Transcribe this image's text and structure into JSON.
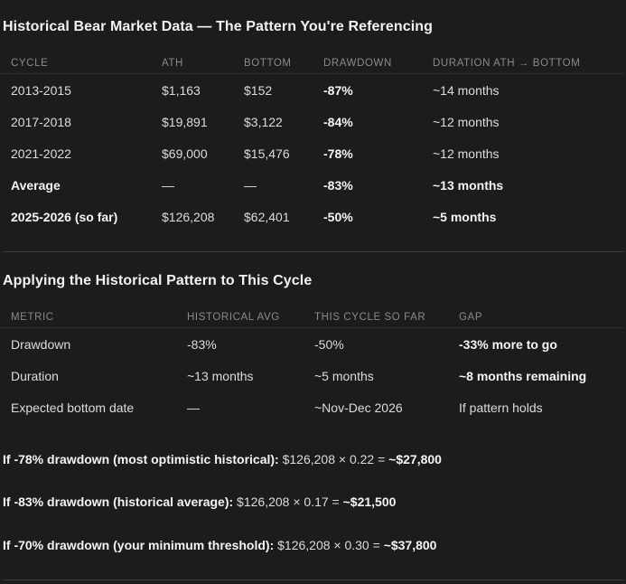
{
  "section1": {
    "title": "Historical Bear Market Data — The Pattern You're Referencing",
    "columns": [
      "CYCLE",
      "ATH",
      "BOTTOM",
      "DRAWDOWN",
      "DURATION ATH → BOTTOM"
    ],
    "rows": [
      {
        "cycle": "2013-2015",
        "ath": "$1,163",
        "bottom": "$152",
        "drawdown": "-87%",
        "duration": "~14 months"
      },
      {
        "cycle": "2017-2018",
        "ath": "$19,891",
        "bottom": "$3,122",
        "drawdown": "-84%",
        "duration": "~12 months"
      },
      {
        "cycle": "2021-2022",
        "ath": "$69,000",
        "bottom": "$15,476",
        "drawdown": "-78%",
        "duration": "~12 months"
      },
      {
        "cycle": "Average",
        "ath": "—",
        "bottom": "—",
        "drawdown": "-83%",
        "duration": "~13 months"
      },
      {
        "cycle": "2025-2026 (so far)",
        "ath": "$126,208",
        "bottom": "$62,401",
        "drawdown": "-50%",
        "duration": "~5 months"
      }
    ]
  },
  "section2": {
    "title": "Applying the Historical Pattern to This Cycle",
    "columns": [
      "METRIC",
      "HISTORICAL AVG",
      "THIS CYCLE SO FAR",
      "GAP"
    ],
    "rows": [
      {
        "metric": "Drawdown",
        "hist": "-83%",
        "current": "-50%",
        "gap": "-33% more to go"
      },
      {
        "metric": "Duration",
        "hist": "~13 months",
        "current": "~5 months",
        "gap": "~8 months remaining"
      },
      {
        "metric": "Expected bottom date",
        "hist": "—",
        "current": "~Nov-Dec 2026",
        "gap": "If pattern holds"
      }
    ]
  },
  "scenarios": [
    {
      "label": "If -78% drawdown (most optimistic historical):",
      "formula": " $126,208 × 0.22 = ",
      "result": "~$27,800"
    },
    {
      "label": "If -83% drawdown (historical average):",
      "formula": " $126,208 × 0.17 = ",
      "result": "~$21,500"
    },
    {
      "label": "If -70% drawdown (your minimum threshold):",
      "formula": " $126,208 × 0.30 = ",
      "result": "~$37,800"
    }
  ]
}
